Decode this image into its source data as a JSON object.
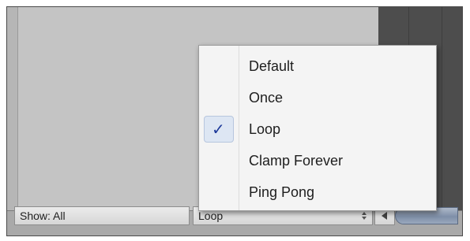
{
  "menu": {
    "items": [
      {
        "label": "Default",
        "checked": false
      },
      {
        "label": "Once",
        "checked": false
      },
      {
        "label": "Loop",
        "checked": true
      },
      {
        "label": "Clamp Forever",
        "checked": false
      },
      {
        "label": "Ping Pong",
        "checked": false
      }
    ],
    "check_glyph": "✓"
  },
  "bottom_bar": {
    "show_label": "Show: All",
    "wrap_mode_value": "Loop"
  },
  "colors": {
    "menu_background": "#f4f4f4",
    "check_color": "#1e3a9a",
    "selection_highlight": "#dde6f3"
  }
}
